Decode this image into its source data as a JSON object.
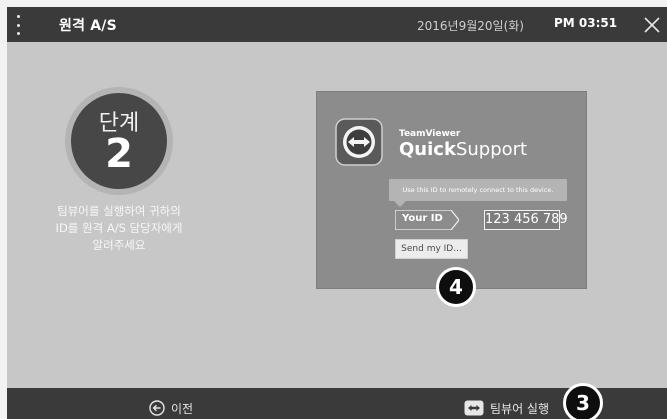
{
  "header": {
    "title": "원격 A/S",
    "date": "2016년9월20일(화)",
    "time": "PM 03:51"
  },
  "step": {
    "word": "단계",
    "number": "2"
  },
  "instructions": {
    "lines": [
      "팀뷰어를 실행하여 귀하의",
      "ID를 원격 A/S 담당자에게",
      "알려주세요"
    ]
  },
  "teamviewer": {
    "brand": "TeamViewer",
    "product_bold": "Quick",
    "product_rest": "Support",
    "hint": "Use this ID to remotely connect to this device.",
    "id_label": "Your ID",
    "id_value": "123 456 789",
    "send_label": "Send my ID..."
  },
  "callouts": {
    "badge_4": "4",
    "badge_3": "3"
  },
  "footer": {
    "prev_label": "이전",
    "run_label": "팀뷰어 실행"
  },
  "colors": {
    "bar": "#3a3a3a",
    "background": "#c7c7c7",
    "step_circle": "#474747",
    "panel": "#8c8c8c"
  }
}
